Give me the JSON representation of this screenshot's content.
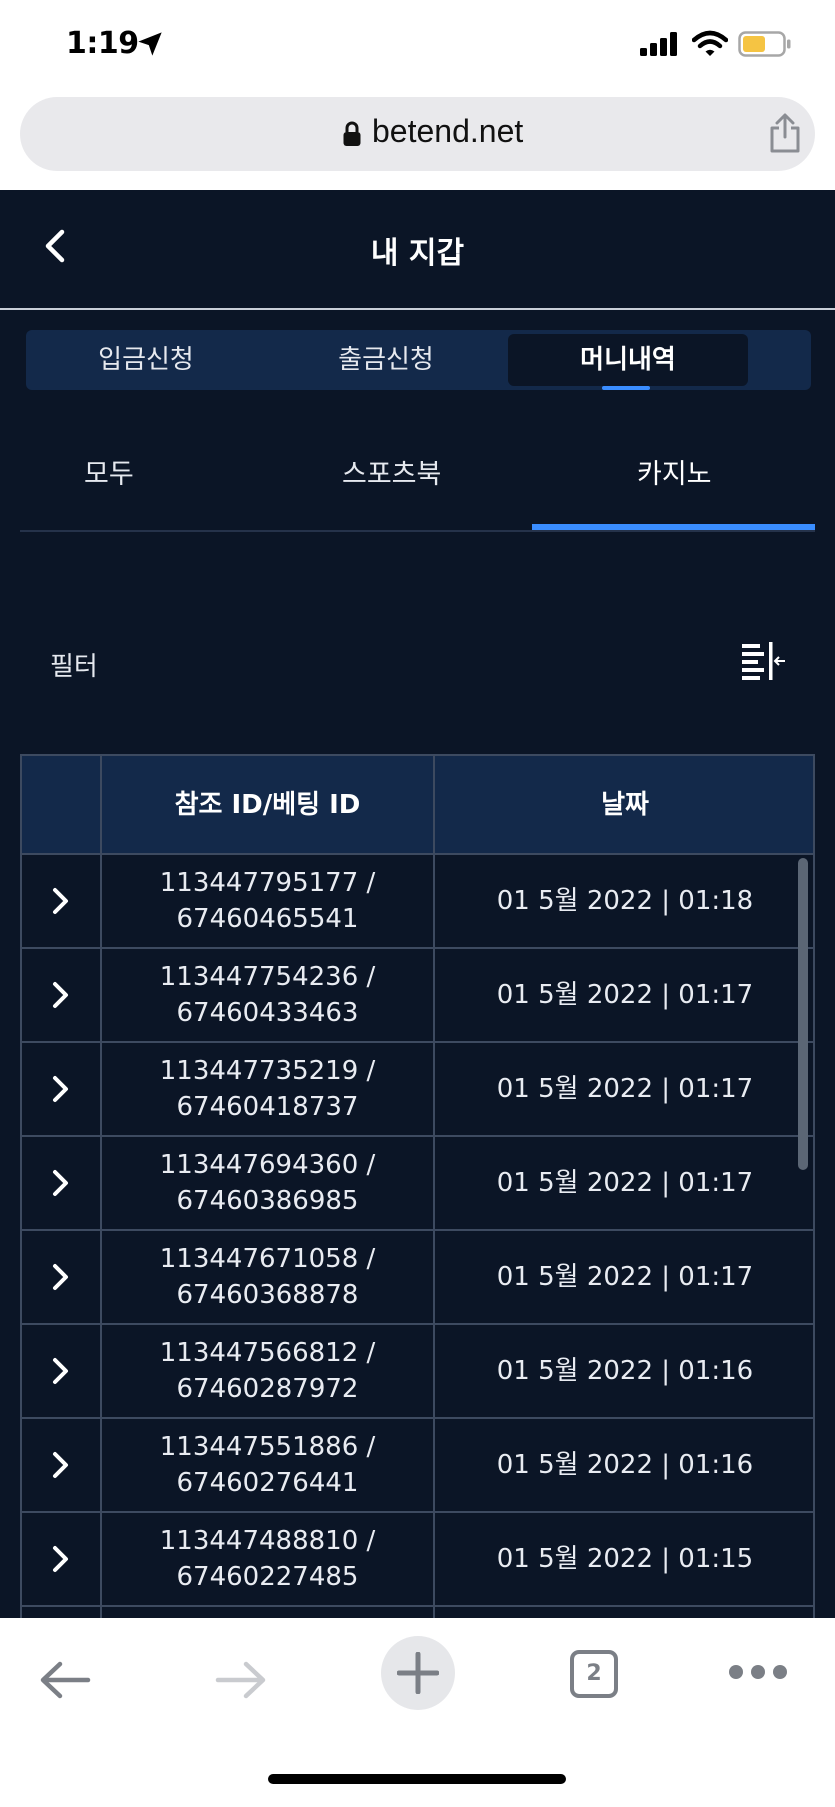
{
  "status_bar": {
    "time": "1:19",
    "battery_color": "#f5c443"
  },
  "browser": {
    "domain": "betend.net",
    "tab_count": "2"
  },
  "header": {
    "title": "내 지갑"
  },
  "main_tabs": [
    {
      "label": "입금신청",
      "active": false
    },
    {
      "label": "출금신청",
      "active": false
    },
    {
      "label": "머니내역",
      "active": true
    }
  ],
  "sub_tabs": [
    {
      "label": "모두",
      "active": false
    },
    {
      "label": "스포츠북",
      "active": false
    },
    {
      "label": "카지노",
      "active": true
    }
  ],
  "filter": {
    "label": "필터"
  },
  "table": {
    "columns": [
      "",
      "참조 ID/베팅 ID",
      "날짜"
    ],
    "rows": [
      {
        "ref_id": "113447795177 /",
        "bet_id": "67460465541",
        "date": "01 5월 2022 | 01:18"
      },
      {
        "ref_id": "113447754236 /",
        "bet_id": "67460433463",
        "date": "01 5월 2022 | 01:17"
      },
      {
        "ref_id": "113447735219 /",
        "bet_id": "67460418737",
        "date": "01 5월 2022 | 01:17"
      },
      {
        "ref_id": "113447694360 /",
        "bet_id": "67460386985",
        "date": "01 5월 2022 | 01:17"
      },
      {
        "ref_id": "113447671058 /",
        "bet_id": "67460368878",
        "date": "01 5월 2022 | 01:17"
      },
      {
        "ref_id": "113447566812 /",
        "bet_id": "67460287972",
        "date": "01 5월 2022 | 01:16"
      },
      {
        "ref_id": "113447551886 /",
        "bet_id": "67460276441",
        "date": "01 5월 2022 | 01:16"
      },
      {
        "ref_id": "113447488810 /",
        "bet_id": "67460227485",
        "date": "01 5월 2022 | 01:15"
      }
    ]
  },
  "colors": {
    "background": "#0b1526",
    "tab_bar": "#13294a",
    "accent": "#3a8dff",
    "grid": "#3d4a60"
  }
}
